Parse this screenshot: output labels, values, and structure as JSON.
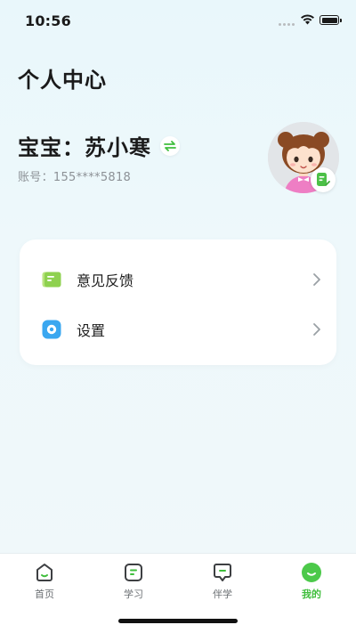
{
  "status_bar": {
    "time": "10:56"
  },
  "header": {
    "title": "个人中心"
  },
  "profile": {
    "name": "宝宝：苏小寒",
    "account": "账号：155****5818",
    "switch_icon": "swap-icon",
    "avatar_icon": "girl-avatar",
    "edit_icon": "edit-icon"
  },
  "menu": {
    "items": [
      {
        "label": "意见反馈",
        "icon": "feedback-icon"
      },
      {
        "label": "设置",
        "icon": "settings-icon"
      }
    ]
  },
  "tab_bar": {
    "tabs": [
      {
        "label": "首页",
        "icon": "home-icon",
        "active": false
      },
      {
        "label": "学习",
        "icon": "study-icon",
        "active": false
      },
      {
        "label": "伴学",
        "icon": "companion-icon",
        "active": false
      },
      {
        "label": "我的",
        "icon": "profile-icon",
        "active": true
      }
    ]
  },
  "colors": {
    "accent": "#3fbe3c",
    "background": "#eef7fb",
    "card": "#ffffff",
    "text_secondary": "#8c9196"
  }
}
